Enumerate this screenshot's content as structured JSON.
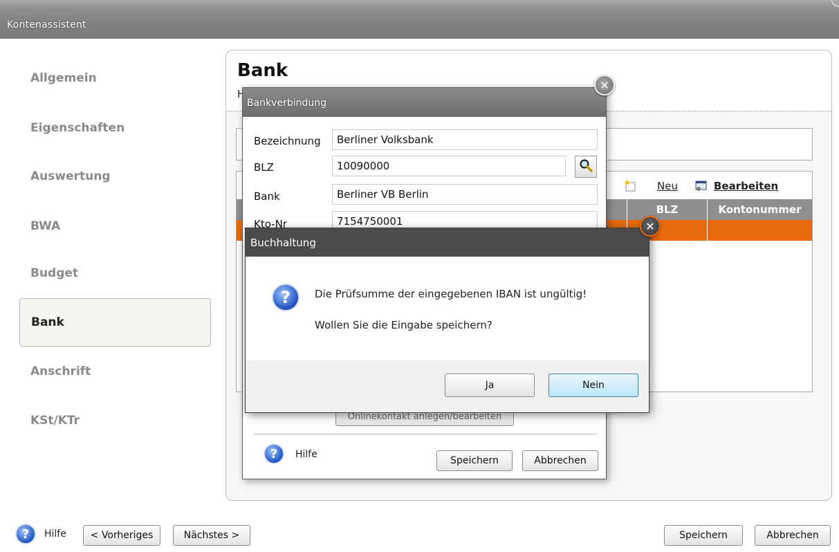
{
  "window": {
    "title": "Kontenassistent"
  },
  "sidebar": {
    "items": [
      {
        "label": "Allgemein"
      },
      {
        "label": "Eigenschaften"
      },
      {
        "label": "Auswertung"
      },
      {
        "label": "BWA"
      },
      {
        "label": "Budget"
      },
      {
        "label": "Bank",
        "active": true
      },
      {
        "label": "Anschrift"
      },
      {
        "label": "KSt/KTr"
      }
    ]
  },
  "main": {
    "title": "Bank",
    "subtitle_visible": "H",
    "grid": {
      "toolbar": {
        "new_label": "Neu",
        "edit_label": "Bearbeiten"
      },
      "columns": [
        "BLZ",
        "Kontonummer"
      ],
      "selected_row_color": "#e86a0a"
    }
  },
  "bankverbindung": {
    "title": "Bankverbindung",
    "fields": {
      "bezeichnung_label": "Bezeichnung",
      "bezeichnung_value": "Berliner Volksbank",
      "blz_label": "BLZ",
      "blz_value": "10090000",
      "bank_label": "Bank",
      "bank_value": "Berliner VB Berlin",
      "kto_label": "Kto-Nr",
      "kto_value": "7154750001"
    },
    "online_button": "Onlinekontakt anlegen/bearbeiten",
    "help_label": "Hilfe",
    "save_label": "Speichern",
    "cancel_label": "Abbrechen"
  },
  "buchhaltung": {
    "title": "Buchhaltung",
    "message_line1": "Die Prüfsumme der eingegebenen IBAN ist ungültig!",
    "message_line2": "Wollen Sie die Eingabe speichern?",
    "yes_label": "Ja",
    "no_label": "Nein"
  },
  "footer": {
    "help_label": "Hilfe",
    "prev_label": "< Vorheriges",
    "next_label": "Nächstes >",
    "save_label": "Speichern",
    "cancel_label": "Abbrechen"
  },
  "icons": {
    "help": "help-circle-icon",
    "close": "close-icon",
    "search": "search-icon",
    "new": "new-document-icon",
    "edit": "edit-icon",
    "question": "question-icon"
  },
  "colors": {
    "accent": "#e86a0a",
    "titlebar": "#8d8d8d"
  }
}
